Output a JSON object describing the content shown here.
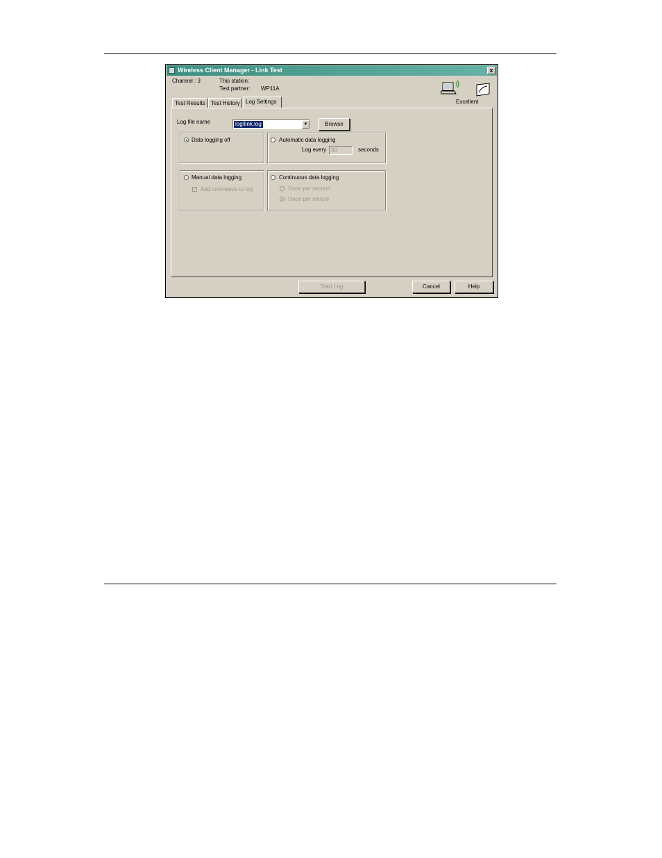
{
  "window": {
    "title": "Wireless Client Manager - Link Test",
    "close_label": "x"
  },
  "header": {
    "channel": "Channel : 3",
    "this_station_label": "This station:",
    "test_partner_label": "Test partner:",
    "test_partner_value": "WP11A",
    "signal_quality": "Excellent"
  },
  "tabs": [
    {
      "label": "Test Results",
      "active": false
    },
    {
      "label": "Test History",
      "active": false
    },
    {
      "label": "Log Settings",
      "active": true
    }
  ],
  "log_settings": {
    "log_file_label": "Log file name",
    "log_file_value": "log\\link.log",
    "browse_label": "Browse",
    "data_logging_off": {
      "label": "Data logging off",
      "checked": true
    },
    "automatic": {
      "label": "Automatic data logging",
      "checked": false,
      "log_every_label": "Log every",
      "log_every_value": "30",
      "seconds_label": "seconds"
    },
    "manual": {
      "label": "Manual data logging",
      "checked": false,
      "add_comments_label": "Add comments to log",
      "add_comments_checked": false
    },
    "continuous": {
      "label": "Continuous data logging",
      "checked": false,
      "once_per_second_label": "Once per second",
      "once_per_minute_label": "Once per minute"
    }
  },
  "buttons": {
    "start_log": "Start Log",
    "cancel": "Cancel",
    "help": "Help"
  }
}
